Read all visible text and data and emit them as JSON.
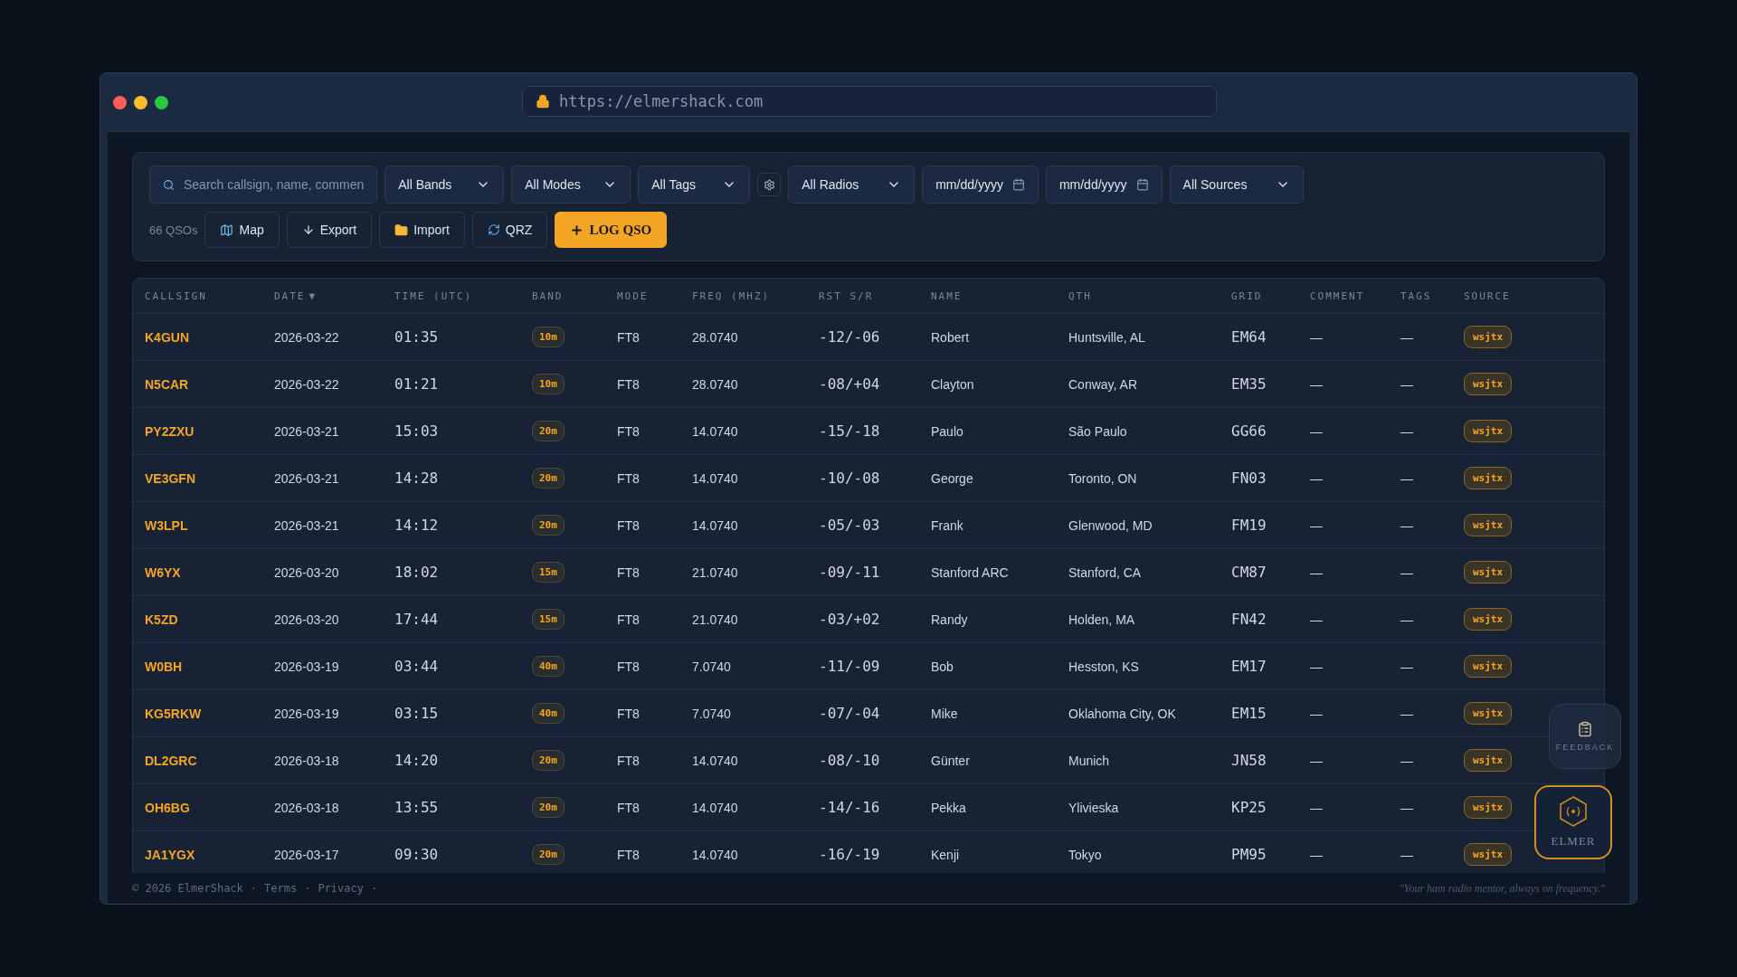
{
  "browser": {
    "url": "https://elmershack.com"
  },
  "toolbar": {
    "search": {
      "placeholder": "Search callsign, name, commen"
    },
    "filters": [
      {
        "kind": "select",
        "label": "All Bands"
      },
      {
        "kind": "select",
        "label": "All Modes"
      },
      {
        "kind": "select",
        "label": "All Tags"
      },
      {
        "kind": "gear"
      },
      {
        "kind": "select",
        "label": "All Radios"
      },
      {
        "kind": "date",
        "placeholder": "mm/dd/yyyy"
      },
      {
        "kind": "date",
        "placeholder": "mm/dd/yyyy"
      },
      {
        "kind": "select",
        "label": "All Sources"
      }
    ],
    "count": "66 QSOs",
    "actions": [
      {
        "kind": "map",
        "label": "Map"
      },
      {
        "kind": "export",
        "label": "Export"
      },
      {
        "kind": "import",
        "label": "Import"
      },
      {
        "kind": "qrz",
        "label": "QRZ"
      },
      {
        "kind": "primary",
        "label": "LOG QSO"
      }
    ]
  },
  "table": {
    "columns": [
      {
        "label": "CALLSIGN"
      },
      {
        "label": "DATE",
        "sort": "▼"
      },
      {
        "label": "TIME (UTC)"
      },
      {
        "label": "BAND"
      },
      {
        "label": "MODE"
      },
      {
        "label": "FREQ (MHZ)"
      },
      {
        "label": "RST S/R"
      },
      {
        "label": "NAME"
      },
      {
        "label": "QTH"
      },
      {
        "label": "GRID"
      },
      {
        "label": "COMMENT"
      },
      {
        "label": "TAGS"
      },
      {
        "label": "SOURCE"
      }
    ],
    "rows": [
      [
        "K4GUN",
        "2026-03-22",
        "01:35",
        "10m",
        "FT8",
        "28.0740",
        "-12/-06",
        "Robert",
        "Huntsville, AL",
        "EM64",
        "—",
        "—",
        "wsjtx"
      ],
      [
        "N5CAR",
        "2026-03-22",
        "01:21",
        "10m",
        "FT8",
        "28.0740",
        "-08/+04",
        "Clayton",
        "Conway, AR",
        "EM35",
        "—",
        "—",
        "wsjtx"
      ],
      [
        "PY2ZXU",
        "2026-03-21",
        "15:03",
        "20m",
        "FT8",
        "14.0740",
        "-15/-18",
        "Paulo",
        "São Paulo",
        "GG66",
        "—",
        "—",
        "wsjtx"
      ],
      [
        "VE3GFN",
        "2026-03-21",
        "14:28",
        "20m",
        "FT8",
        "14.0740",
        "-10/-08",
        "George",
        "Toronto, ON",
        "FN03",
        "—",
        "—",
        "wsjtx"
      ],
      [
        "W3LPL",
        "2026-03-21",
        "14:12",
        "20m",
        "FT8",
        "14.0740",
        "-05/-03",
        "Frank",
        "Glenwood, MD",
        "FM19",
        "—",
        "—",
        "wsjtx"
      ],
      [
        "W6YX",
        "2026-03-20",
        "18:02",
        "15m",
        "FT8",
        "21.0740",
        "-09/-11",
        "Stanford ARC",
        "Stanford, CA",
        "CM87",
        "—",
        "—",
        "wsjtx"
      ],
      [
        "K5ZD",
        "2026-03-20",
        "17:44",
        "15m",
        "FT8",
        "21.0740",
        "-03/+02",
        "Randy",
        "Holden, MA",
        "FN42",
        "—",
        "—",
        "wsjtx"
      ],
      [
        "W0BH",
        "2026-03-19",
        "03:44",
        "40m",
        "FT8",
        "7.0740",
        "-11/-09",
        "Bob",
        "Hesston, KS",
        "EM17",
        "—",
        "—",
        "wsjtx"
      ],
      [
        "KG5RKW",
        "2026-03-19",
        "03:15",
        "40m",
        "FT8",
        "7.0740",
        "-07/-04",
        "Mike",
        "Oklahoma City, OK",
        "EM15",
        "—",
        "—",
        "wsjtx"
      ],
      [
        "DL2GRC",
        "2026-03-18",
        "14:20",
        "20m",
        "FT8",
        "14.0740",
        "-08/-10",
        "Günter",
        "Munich",
        "JN58",
        "—",
        "—",
        "wsjtx"
      ],
      [
        "OH6BG",
        "2026-03-18",
        "13:55",
        "20m",
        "FT8",
        "14.0740",
        "-14/-16",
        "Pekka",
        "Ylivieska",
        "KP25",
        "—",
        "—",
        "wsjtx"
      ],
      [
        "JA1YGX",
        "2026-03-17",
        "09:30",
        "20m",
        "FT8",
        "14.0740",
        "-16/-19",
        "Kenji",
        "Tokyo",
        "PM95",
        "—",
        "—",
        "wsjtx"
      ]
    ]
  },
  "footer": {
    "copyright": "© 2026 ElmerShack",
    "links": [
      "Terms",
      "Privacy"
    ],
    "separator": "·",
    "tagline": "\"Your ham radio mentor, always on frequency.\""
  },
  "feedback": {
    "label": "FEEDBACK"
  },
  "assistant": {
    "label": "ELMER"
  }
}
